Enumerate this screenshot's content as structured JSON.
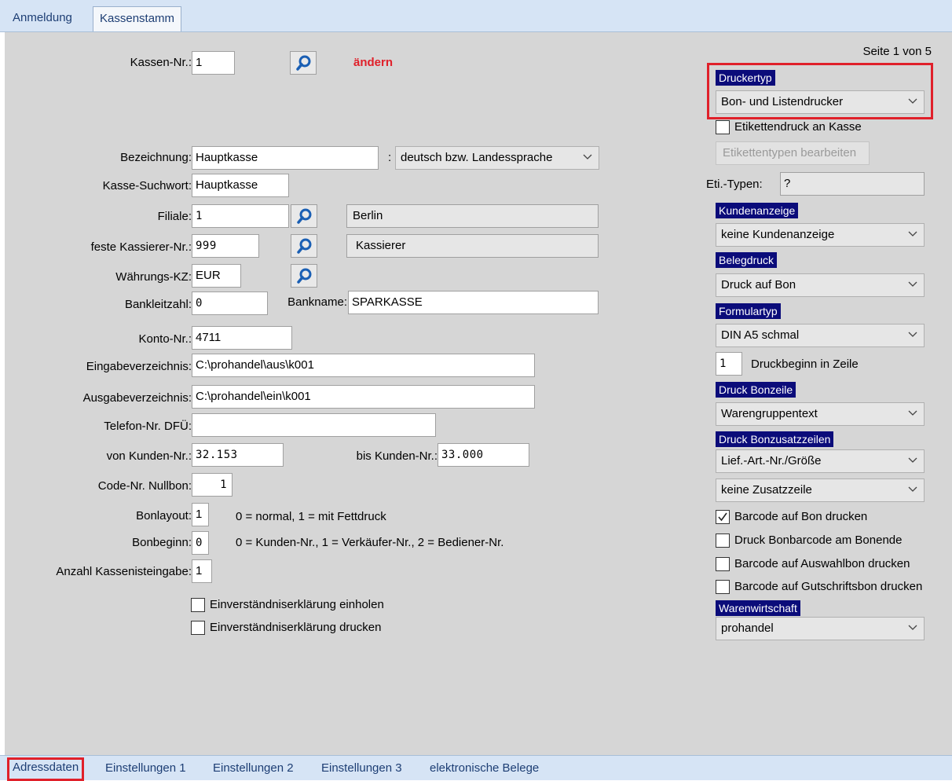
{
  "top_tabs": [
    {
      "label": "Anmeldung",
      "active": false
    },
    {
      "label": "Kassenstamm",
      "active": true
    }
  ],
  "page_info": "Seite 1 von 5",
  "form": {
    "kassen_nr": {
      "label": "Kassen-Nr.:",
      "value": "1"
    },
    "aendern": "ändern",
    "bezeichnung": {
      "label": "Bezeichnung:",
      "value": "Hauptkasse"
    },
    "sprache_sep": ":",
    "sprache": "deutsch bzw. Landessprache",
    "suchwort": {
      "label": "Kasse-Suchwort:",
      "value": "Hauptkasse"
    },
    "filiale": {
      "label": "Filiale:",
      "value": "1",
      "name": "Berlin"
    },
    "kassierer": {
      "label": "feste Kassierer-Nr.:",
      "value": "999",
      "name": "Kassierer"
    },
    "waehrung": {
      "label": "Währungs-KZ:",
      "value": "EUR"
    },
    "bankleitzahl": {
      "label": "Bankleitzahl:",
      "value": "0"
    },
    "bankname": {
      "label": "Bankname:",
      "value": "SPARKASSE"
    },
    "konto": {
      "label": "Konto-Nr.:",
      "value": "4711"
    },
    "eingabe": {
      "label": "Eingabeverzeichnis:",
      "value": "C:\\prohandel\\aus\\k001"
    },
    "ausgabe": {
      "label": "Ausgabeverzeichnis:",
      "value": "C:\\prohandel\\ein\\k001"
    },
    "telefon": {
      "label": "Telefon-Nr. DFÜ:",
      "value": ""
    },
    "von_kunden": {
      "label": "von Kunden-Nr.:",
      "value": "32.153"
    },
    "bis_kunden": {
      "label": "bis Kunden-Nr.:",
      "value": "33.000"
    },
    "code_nullbon": {
      "label": "Code-Nr. Nullbon:",
      "value": "1"
    },
    "bonlayout": {
      "label": "Bonlayout:",
      "value": "1",
      "hint": "0 = normal, 1 = mit Fettdruck"
    },
    "bonbeginn": {
      "label": "Bonbeginn:",
      "value": "0",
      "hint": "0 = Kunden-Nr., 1 = Verkäufer-Nr., 2 = Bediener-Nr."
    },
    "anzahl": {
      "label": "Anzahl Kassenisteingabe:",
      "value": "1"
    },
    "einverst_einholen": {
      "label": "Einverständniserklärung einholen",
      "checked": false
    },
    "einverst_drucken": {
      "label": "Einverständniserklärung drucken",
      "checked": false
    }
  },
  "right": {
    "druckertyp": {
      "header": "Druckertyp",
      "value": "Bon- und Listendrucker"
    },
    "etikettendruck": {
      "label": "Etikettendruck an Kasse",
      "checked": false
    },
    "etikettentypen_btn": "Etikettentypen bearbeiten",
    "eti_typen": {
      "label": "Eti.-Typen:",
      "value": "?"
    },
    "kundenanzeige": {
      "header": "Kundenanzeige",
      "value": "keine Kundenanzeige"
    },
    "belegdruck": {
      "header": "Belegdruck",
      "value": "Druck auf Bon"
    },
    "formulartyp": {
      "header": "Formulartyp",
      "value": "DIN A5 schmal"
    },
    "druckbeginn": {
      "value": "1",
      "label": "Druckbeginn in Zeile"
    },
    "bonzeile": {
      "header": "Druck Bonzeile",
      "value": "Warengruppentext"
    },
    "bonzusatz": {
      "header": "Druck Bonzusatzzeilen",
      "value1": "Lief.-Art.-Nr./Größe",
      "value2": "keine Zusatzzeile"
    },
    "cb_barcode_bon": {
      "label": "Barcode auf Bon drucken",
      "checked": true
    },
    "cb_bonbarcode_ende": {
      "label": "Druck Bonbarcode am Bonende",
      "checked": false
    },
    "cb_barcode_auswahl": {
      "label": "Barcode auf Auswahlbon drucken",
      "checked": false
    },
    "cb_barcode_gutschrift": {
      "label": "Barcode auf Gutschriftsbon drucken",
      "checked": false
    },
    "warenwirtschaft": {
      "header": "Warenwirtschaft",
      "value": "prohandel"
    }
  },
  "bottom_tabs": [
    {
      "label": "Adressdaten",
      "active": true
    },
    {
      "label": "Einstellungen 1",
      "active": false
    },
    {
      "label": "Einstellungen 2",
      "active": false
    },
    {
      "label": "Einstellungen 3",
      "active": false
    },
    {
      "label": "elektronische Belege",
      "active": false
    }
  ],
  "colors": {
    "accent_red": "#e0202a",
    "header_navy": "#0b0c7a",
    "tab_blue": "#d6e4f5"
  }
}
